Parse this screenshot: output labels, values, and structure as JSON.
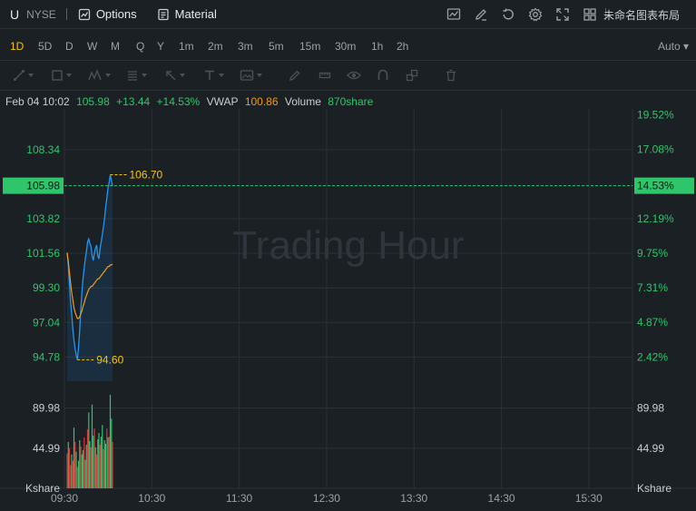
{
  "header": {
    "symbol": "U",
    "exchange": "NYSE",
    "options_label": "Options",
    "material_label": "Material",
    "layout_name": "未命名图表布局",
    "icons": [
      "chart-style-icon",
      "draw-icon",
      "replay-icon",
      "settings-icon",
      "fullscreen-icon",
      "grid-layout-icon"
    ]
  },
  "periods": {
    "items": [
      "1D",
      "5D",
      "D",
      "W",
      "M",
      "Q",
      "Y",
      "1m",
      "2m",
      "3m",
      "5m",
      "15m",
      "30m",
      "1h",
      "2h"
    ],
    "active": "1D",
    "auto_label": "Auto"
  },
  "tools": [
    "trend-line-icon",
    "rectangle-icon",
    "pattern-icon",
    "fib-icon",
    "arrow-icon",
    "text-icon",
    "image-icon",
    "pen-icon",
    "eye-icon",
    "magnet-icon",
    "link-icon",
    "trash-icon"
  ],
  "info": {
    "date": "Feb 04 10:02",
    "price": "105.98",
    "change": "+13.44",
    "change_pct": "+14.53%",
    "vwap_label": "VWAP",
    "vwap": "100.86",
    "volume_label": "Volume",
    "volume": "870share"
  },
  "colors": {
    "background": "#1b2025",
    "up": "#2ec56b",
    "down": "#e0353b",
    "price_line": "#2196f3",
    "vwap_line": "#f39c12",
    "annotation": "#f5c400",
    "grid": "#2a3037"
  },
  "chart_data": {
    "type": "line",
    "watermark": "Trading Hour",
    "x_ticks": [
      "09:30",
      "10:30",
      "11:30",
      "12:30",
      "13:30",
      "14:30",
      "15:30"
    ],
    "price_axis": {
      "ticks": [
        "108.34",
        "105.98",
        "103.82",
        "101.56",
        "99.30",
        "97.04",
        "94.78"
      ],
      "ylim": [
        93.2,
        111.0
      ]
    },
    "pct_axis": {
      "ticks": [
        "19.52%",
        "17.08%",
        "14.53%",
        "12.19%",
        "9.75%",
        "7.31%",
        "4.87%",
        "2.42%"
      ]
    },
    "current_price": {
      "value": 105.98,
      "label": "105.98",
      "pct_label": "14.53%"
    },
    "high_annotation": {
      "value": 106.7,
      "label": "106.70"
    },
    "low_annotation": {
      "value": 94.6,
      "label": "94.60"
    },
    "series": [
      {
        "name": "Price",
        "values": [
          101.6,
          100.8,
          99.6,
          98.4,
          97.6,
          96.6,
          95.9,
          95.3,
          94.9,
          94.6,
          95.4,
          96.5,
          97.9,
          99.0,
          99.9,
          100.6,
          101.2,
          101.7,
          102.3,
          102.5,
          102.2,
          102.0,
          101.4,
          101.1,
          101.6,
          101.9,
          102.1,
          101.4,
          101.2,
          101.9,
          102.3,
          102.8,
          103.3,
          103.9,
          104.6,
          105.2,
          105.8,
          106.2,
          106.7,
          106.3,
          105.98
        ]
      },
      {
        "name": "VWAP",
        "values": [
          101.6,
          101.0,
          100.3,
          99.6,
          99.0,
          98.5,
          98.0,
          97.7,
          97.5,
          97.3,
          97.3,
          97.4,
          97.6,
          97.8,
          98.1,
          98.3,
          98.6,
          98.8,
          99.0,
          99.2,
          99.3,
          99.4,
          99.4,
          99.5,
          99.6,
          99.7,
          99.8,
          99.9,
          99.9,
          100.0,
          100.1,
          100.2,
          100.3,
          100.4,
          100.5,
          100.6,
          100.7,
          100.7,
          100.8,
          100.8,
          100.86
        ]
      }
    ],
    "volume": {
      "ticks": [
        "89.98",
        "44.99"
      ],
      "unit_label": "Kshare",
      "ylim": [
        0,
        110
      ],
      "values": [
        39,
        52,
        45,
        26,
        38,
        31,
        68,
        52,
        41,
        24,
        31,
        54,
        47,
        38,
        43,
        57,
        32,
        49,
        66,
        85,
        53,
        46,
        94,
        59,
        67,
        46,
        38,
        55,
        62,
        49,
        58,
        71,
        44,
        54,
        50,
        67,
        57,
        58,
        105,
        78,
        52
      ],
      "up": [
        false,
        true,
        false,
        false,
        true,
        false,
        true,
        false,
        true,
        false,
        true,
        true,
        false,
        true,
        true,
        false,
        true,
        true,
        false,
        true,
        true,
        false,
        true,
        true,
        false,
        true,
        false,
        true,
        true,
        false,
        true,
        true,
        false,
        true,
        true,
        false,
        true,
        false,
        true,
        true,
        false
      ]
    }
  }
}
